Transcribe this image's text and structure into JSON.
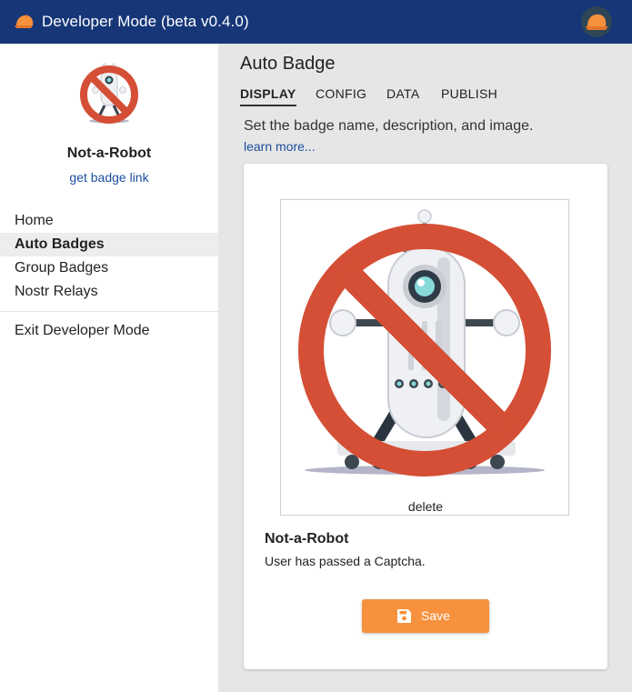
{
  "app": {
    "title": "Developer Mode (beta v0.4.0)",
    "logo_icon": "orange-cap-icon",
    "brand_color": "#163678",
    "accent_color": "#f7913d"
  },
  "sidebar": {
    "badge_name": "Not-a-Robot",
    "badge_link": "get badge link",
    "nav": [
      {
        "label": "Home",
        "active": false
      },
      {
        "label": "Auto Badges",
        "active": true
      },
      {
        "label": "Group Badges",
        "active": false
      },
      {
        "label": "Nostr Relays",
        "active": false
      }
    ],
    "exit_label": "Exit Developer Mode"
  },
  "main": {
    "title": "Auto Badge",
    "tabs": [
      {
        "label": "DISPLAY",
        "active": true
      },
      {
        "label": "CONFIG",
        "active": false
      },
      {
        "label": "DATA",
        "active": false
      },
      {
        "label": "PUBLISH",
        "active": false
      }
    ],
    "description": "Set the badge name, description, and image.",
    "learn_more": "learn more...",
    "card": {
      "delete_label": "delete",
      "badge_name": "Not-a-Robot",
      "badge_description": "User has passed a Captcha.",
      "save_label": "Save",
      "save_icon": "floppy-disk-icon"
    }
  }
}
